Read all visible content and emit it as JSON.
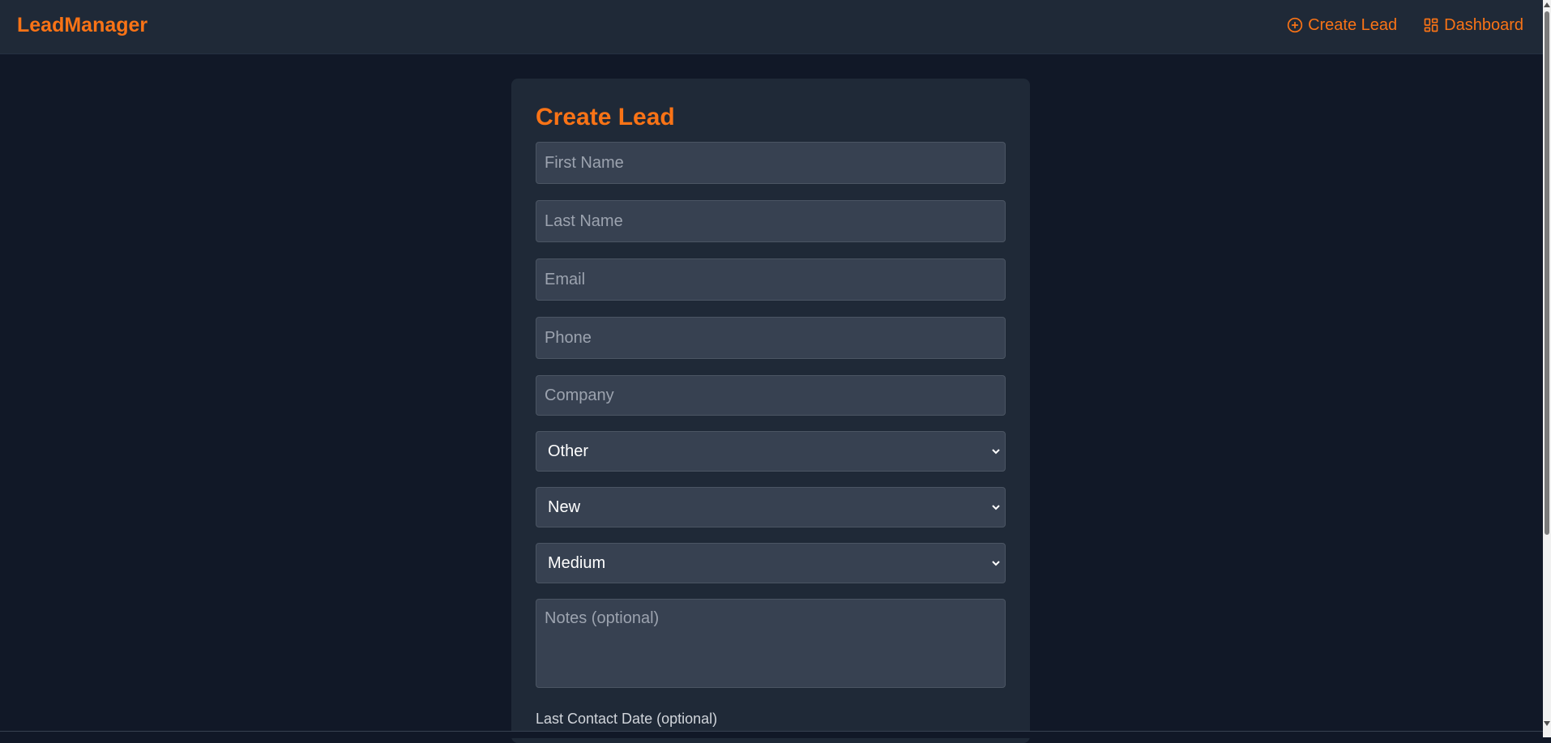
{
  "app": {
    "brand": "LeadManager",
    "accent_color": "#f97316"
  },
  "nav": {
    "create_lead": {
      "label": "Create Lead",
      "icon": "plus-circle-icon"
    },
    "dashboard": {
      "label": "Dashboard",
      "icon": "grid-icon"
    }
  },
  "form": {
    "title": "Create Lead",
    "first_name": {
      "placeholder": "First Name",
      "value": ""
    },
    "last_name": {
      "placeholder": "Last Name",
      "value": ""
    },
    "email": {
      "placeholder": "Email",
      "value": ""
    },
    "phone": {
      "placeholder": "Phone",
      "value": ""
    },
    "company": {
      "placeholder": "Company",
      "value": ""
    },
    "source_select": {
      "selected": "Other"
    },
    "status_select": {
      "selected": "New"
    },
    "priority_select": {
      "selected": "Medium"
    },
    "notes": {
      "placeholder": "Notes (optional)",
      "value": ""
    },
    "last_contact_label": "Last Contact Date (optional)"
  }
}
